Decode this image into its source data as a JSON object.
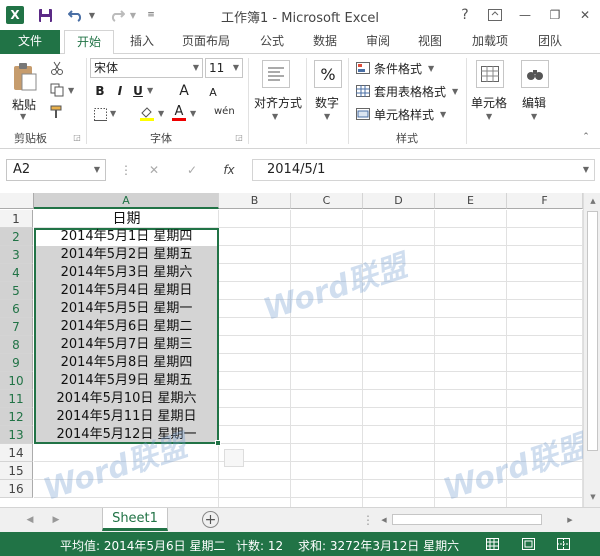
{
  "window": {
    "title": "工作簿1 - Microsoft Excel",
    "help": "?",
    "minimize": "—",
    "restore": "❐",
    "close": "✕"
  },
  "qat": {
    "app_icon": "X",
    "save_icon": "save-icon",
    "undo_icon": "undo-icon",
    "redo_icon": "redo-icon"
  },
  "tabs": [
    {
      "label": "文件"
    },
    {
      "label": "开始"
    },
    {
      "label": "插入"
    },
    {
      "label": "页面布局"
    },
    {
      "label": "公式"
    },
    {
      "label": "数据"
    },
    {
      "label": "审阅"
    },
    {
      "label": "视图"
    },
    {
      "label": "加载项"
    },
    {
      "label": "团队"
    }
  ],
  "ribbon": {
    "paste_label": "粘贴",
    "clipboard_group": "剪贴板",
    "font_name": "宋体",
    "font_size": "11",
    "bold": "B",
    "italic": "I",
    "underline": "U",
    "grow_font": "A",
    "shrink_font": "A",
    "font_color_letter": "A",
    "phonetic": "wén",
    "font_group": "字体",
    "alignment_label": "对齐方式",
    "number_label": "数字",
    "percent_symbol": "%",
    "cond_format": "条件格式",
    "table_format": "套用表格格式",
    "cell_style": "单元格样式",
    "styles_group": "样式",
    "cells_label": "单元格",
    "edit_label": "编辑"
  },
  "formula": {
    "name_box": "A2",
    "cancel": "✕",
    "enter": "✓",
    "fx": "fx",
    "content": "2014/5/1"
  },
  "columns": [
    "A",
    "B",
    "C",
    "D",
    "E",
    "F"
  ],
  "rows": [
    "1",
    "2",
    "3",
    "4",
    "5",
    "6",
    "7",
    "8",
    "9",
    "10",
    "11",
    "12",
    "13",
    "14",
    "15",
    "16"
  ],
  "cells": {
    "A1": "日期",
    "A2": "2014年5月1日  星期四",
    "A3": "2014年5月2日  星期五",
    "A4": "2014年5月3日  星期六",
    "A5": "2014年5月4日  星期日",
    "A6": "2014年5月5日  星期一",
    "A7": "2014年5月6日  星期二",
    "A8": "2014年5月7日  星期三",
    "A9": "2014年5月8日  星期四",
    "A10": "2014年5月9日  星期五",
    "A11": "2014年5月10日  星期六",
    "A12": "2014年5月11日  星期日",
    "A13": "2014年5月12日  星期一"
  },
  "sheets": [
    {
      "label": "Sheet1"
    }
  ],
  "add_sheet": "+",
  "status": {
    "average": "平均值: 2014年5月6日 星期二",
    "count": "计数: 12",
    "sum": "求和: 3272年3月12日 星期六"
  },
  "watermark": {
    "word": "Word",
    "cn": "联盟"
  },
  "colors": {
    "accent": "#217346",
    "selection": "#d4d4d4",
    "border": "#d4d4d4"
  }
}
